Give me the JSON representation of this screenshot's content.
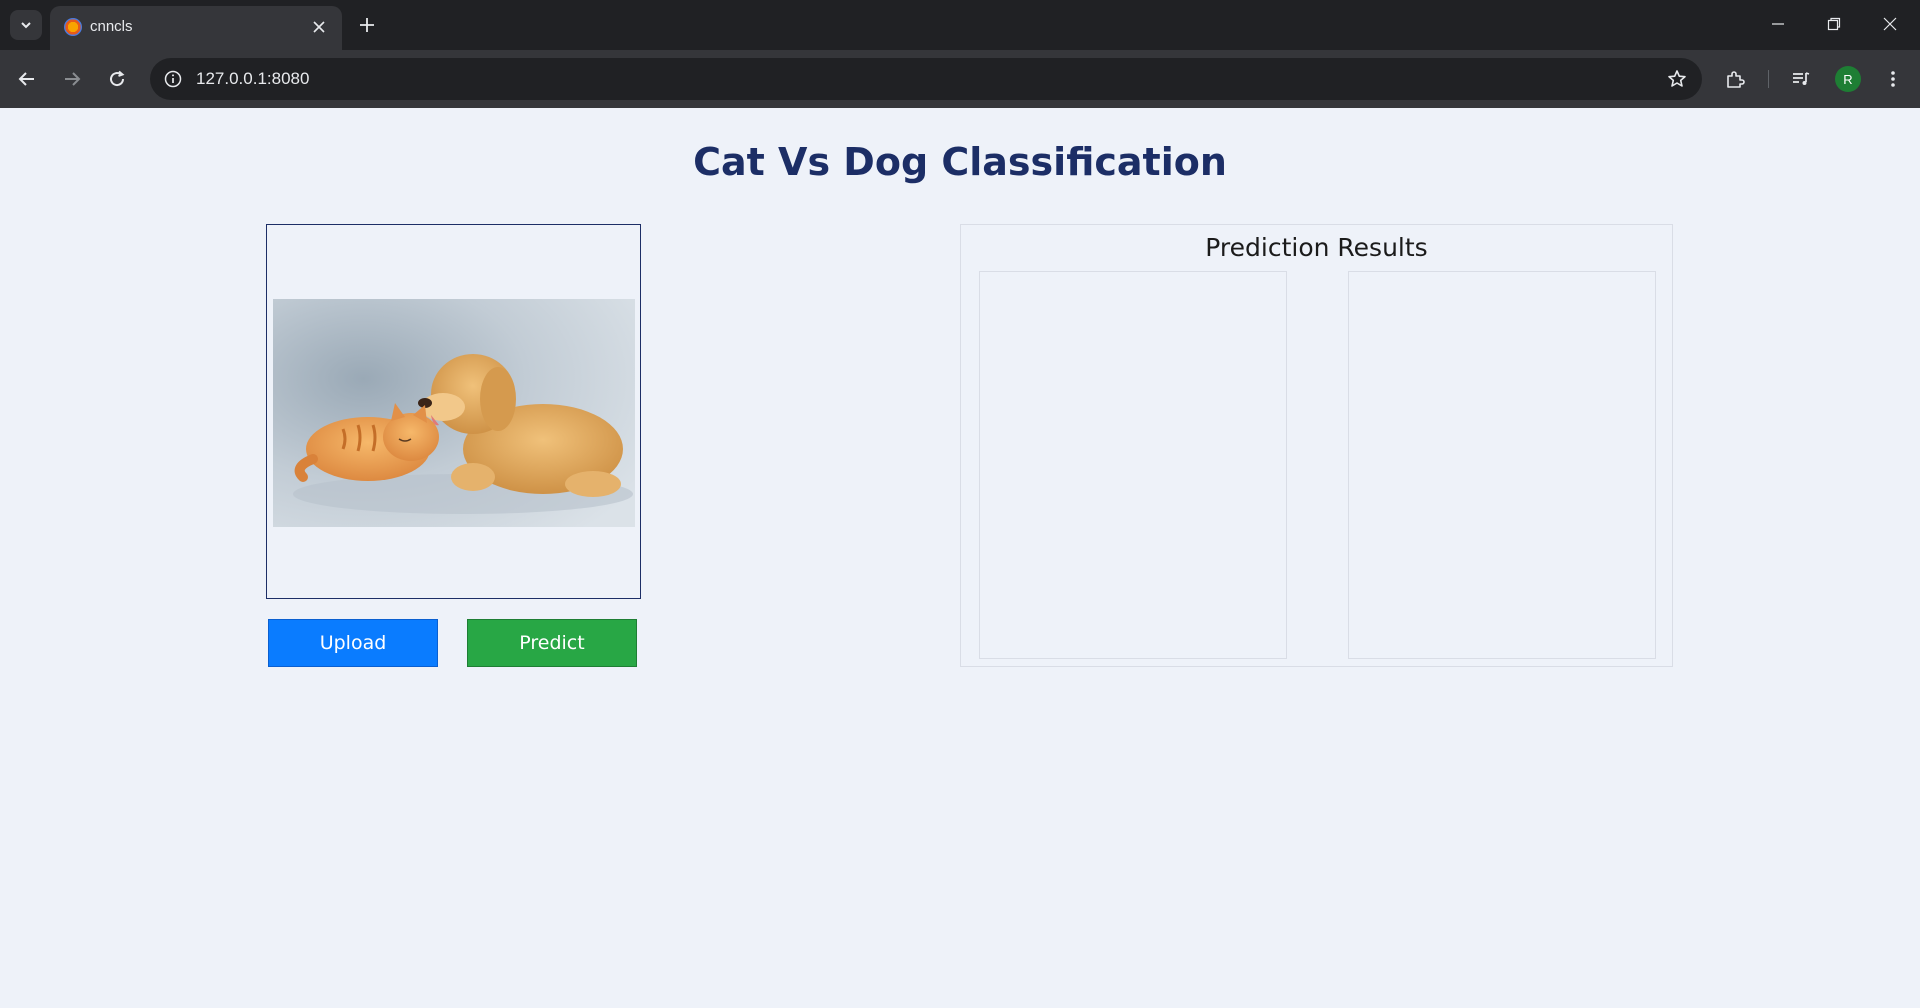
{
  "browser": {
    "tab_title": "cnncls",
    "url": "127.0.0.1:8080",
    "profile_initial": "R"
  },
  "page": {
    "title": "Cat Vs Dog Classification",
    "upload_label": "Upload",
    "predict_label": "Predict",
    "results_title": "Prediction Results",
    "colors": {
      "title": "#1c2e66",
      "upload_button": "#0a7cff",
      "predict_button": "#28a745",
      "background": "#eef2f9"
    }
  }
}
